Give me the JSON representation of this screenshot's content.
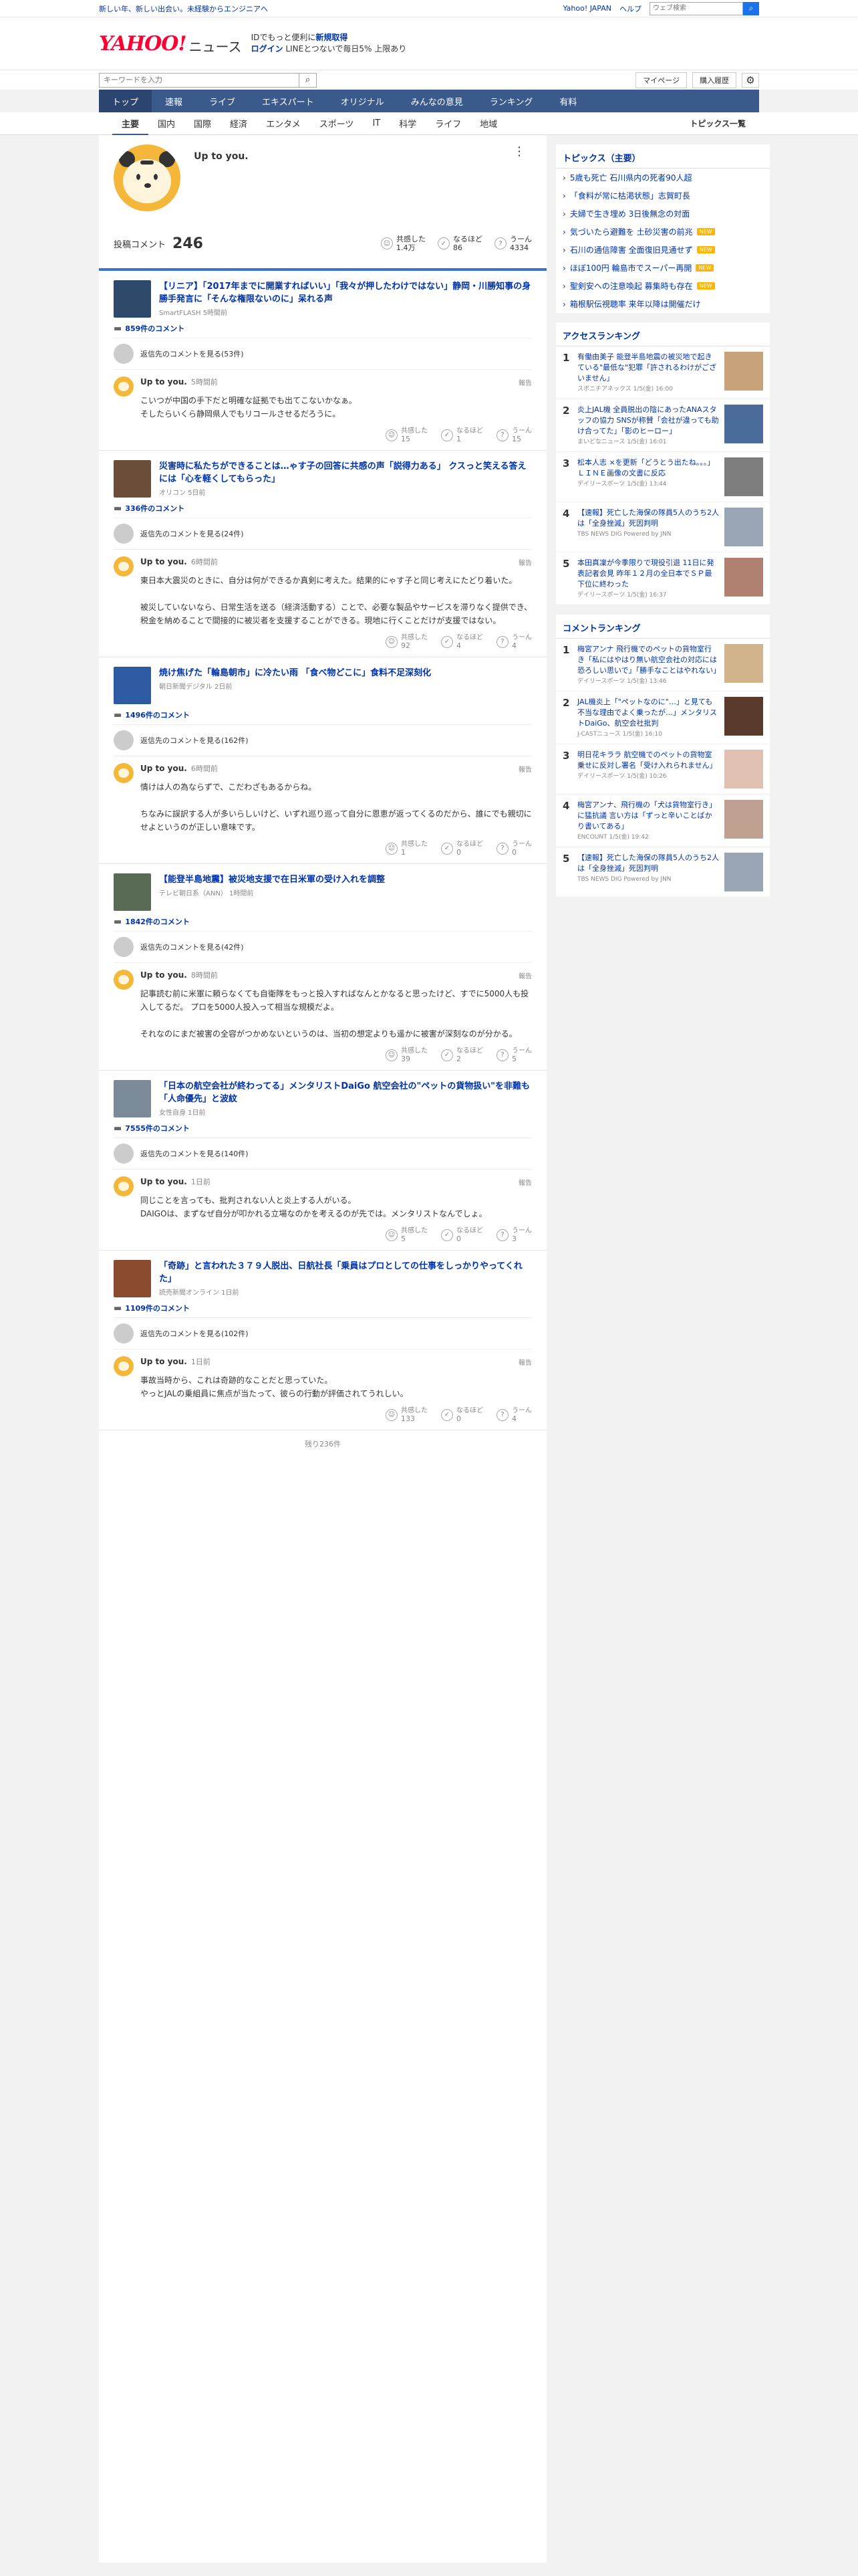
{
  "topbar": {
    "promo": "新しい年、新しい出会い。未経験からエンジニアへ",
    "links": [
      "Yahoo! JAPAN",
      "ヘルプ"
    ],
    "search_placeholder": "ウェブ検索"
  },
  "header": {
    "logo_text": "YAHOO!",
    "logo_sub": "JAPAN",
    "logo_service": "ニュース",
    "promo_line1_a": "IDでもっと便利に",
    "promo_line1_b": "新規取得",
    "promo_line2_a": "ログイン",
    "promo_line2_b": "LINEとつないで毎日5%",
    "promo_line2_c": "上限あり"
  },
  "subbar": {
    "keyword_placeholder": "キーワードを入力",
    "mypage": "マイページ",
    "purchase": "購入履歴"
  },
  "gnav": [
    "トップ",
    "速報",
    "ライブ",
    "エキスパート",
    "オリジナル",
    "みんなの意見",
    "ランキング",
    "有料"
  ],
  "cnav": [
    "主要",
    "国内",
    "国際",
    "経済",
    "エンタメ",
    "スポーツ",
    "IT",
    "科学",
    "ライフ",
    "地域"
  ],
  "cnav_all": "トピックス一覧",
  "profile": {
    "name": "Up to you.",
    "comments_label": "投稿コメント",
    "comments_count": "246",
    "reactions": [
      {
        "label": "共感した",
        "value": "1.4万"
      },
      {
        "label": "なるほど",
        "value": "86"
      },
      {
        "label": "うーん",
        "value": "4334"
      }
    ]
  },
  "reaction_labels": [
    "共感した",
    "なるほど",
    "うーん"
  ],
  "blocks": [
    {
      "title": "【リニア】「2017年までに開業すればいい」「我々が押したわけではない」静岡・川勝知事の身勝手発言に「そんな権限ないのに」呆れる声",
      "source": "SmartFLASH 5時間前",
      "count": "859件のコメント",
      "reply_line": "返信先のコメントを見る(53件)",
      "time": "5時間前",
      "text": "こいつが中国の手下だと明確な証拠でも出てこないかなぁ。\nそしたらいくら静岡県人でもリコールさせるだろうに。",
      "r": [
        "15",
        "1",
        "15"
      ]
    },
    {
      "title": "災害時に私たちができることは…ゃす子の回答に共感の声「説得力ある」 クスっと笑える答えには「心を軽くしてもらった」",
      "source": "オリコン 5日前",
      "count": "336件のコメント",
      "reply_line": "返信先のコメントを見る(24件)",
      "time": "6時間前",
      "text": "東日本大震災のときに、自分は何ができるか真剣に考えた。結果的にゃす子と同じ考えにたどり着いた。\n\n被災していないなら、日常生活を送る（経済活動する）ことで、必要な製品やサービスを滞りなく提供でき、税金を納めることで間接的に被災者を支援することができる。現地に行くことだけが支援ではない。",
      "r": [
        "92",
        "4",
        "4"
      ]
    },
    {
      "title": "焼け焦げた「輪島朝市」に冷たい雨 「食べ物どこに」食料不足深刻化",
      "source": "朝日新聞デジタル 2日前",
      "count": "1496件のコメント",
      "reply_line": "返信先のコメントを見る(162件)",
      "time": "6時間前",
      "text": "情けは人の為ならずで、こだわざもあるからね。\n\nちなみに誤訳する人が多いらしいけど、いずれ巡り巡って自分に恩恵が返ってくるのだから、誰にでも親切にせよというのが正しい意味です。",
      "r": [
        "1",
        "0",
        "0"
      ]
    },
    {
      "title": "【能登半島地震】被災地支援で在日米軍の受け入れを調整",
      "source": "テレビ朝日系（ANN） 1時間前",
      "count": "1842件のコメント",
      "reply_line": "返信先のコメントを見る(42件)",
      "time": "8時間前",
      "text": "記事読む前に米軍に頼らなくても自衛隊をもっと投入すればなんとかなると思ったけど、すでに5000人も投入してるだ。 プロを5000人投入って相当な規模だよ。\n\nそれなのにまだ被害の全容がつかめないというのは、当初の想定よりも遥かに被害が深刻なのが分かる。",
      "r": [
        "39",
        "2",
        "5"
      ]
    },
    {
      "title": "「日本の航空会社が終わってる」メンタリストDaiGo 航空会社の\"ペットの貨物扱い\"を非難も「人命優先」と波紋",
      "source": "女性自身 1日前",
      "count": "7555件のコメント",
      "reply_line": "返信先のコメントを見る(140件)",
      "time": "1日前",
      "text": "同じことを言っても、批判されない人と炎上する人がいる。\nDAIGOは、まずなぜ自分が叩かれる立場なのかを考えるのが先では。メンタリストなんでしょ。",
      "r": [
        "5",
        "0",
        "3"
      ]
    },
    {
      "title": "「奇跡」と言われた３７９人脱出、日航社長「乗員はプロとしての仕事をしっかりやってくれた」",
      "source": "読売新聞オンライン 1日前",
      "count": "1109件のコメント",
      "reply_line": "返信先のコメントを見る(102件)",
      "time": "1日前",
      "text": "事故当時から、これは奇跡的なことだと思っていた。\nやっとJALの乗組員に焦点が当たって、彼らの行動が評価されてうれしい。",
      "r": [
        "133",
        "0",
        "4"
      ]
    }
  ],
  "pager": "残り236件",
  "side": {
    "topics_title": "トピックス（主要）",
    "topics": [
      {
        "t": "5歳も死亡 石川県内の死者90人超",
        "b": ""
      },
      {
        "t": "「食料が常に枯渇状態」志賀町長",
        "b": ""
      },
      {
        "t": "夫婦で生き埋め 3日後無念の対面",
        "b": ""
      },
      {
        "t": "気づいたら避難を 土砂災害の前兆",
        "b": "NEW"
      },
      {
        "t": "石川の通信障害 全面復旧見通せず",
        "b": "NEW"
      },
      {
        "t": "ほぼ100円 輪島市でスーパー再開",
        "b": "NEW"
      },
      {
        "t": "聖剣安への注意喚起 募集時も存在",
        "b": "NEW"
      },
      {
        "t": "箱根駅伝視聴率 来年以降は開催だけ",
        "b": ""
      }
    ],
    "access_title": "アクセスランキング",
    "access": [
      {
        "no": "1",
        "t": "有働由美子 能登半島地震の被災地で起きている\"最低な\"犯罪「許されるわけがございません」",
        "s": "スポニチアネックス 1/5(金) 16:00"
      },
      {
        "no": "2",
        "t": "炎上JAL機 全員脱出の陰にあったANAスタッフの協力 SNSが称賛「会社が違っても助け合ってた」「影のヒーロー」",
        "s": "まいどなニュース 1/5(金) 16:01"
      },
      {
        "no": "3",
        "t": "松本人志 ×を更新「どうとう出たね。。。」ＬＩＮＥ画像の文書に反応",
        "s": "デイリースポーツ 1/5(金) 13:44"
      },
      {
        "no": "4",
        "t": "【速報】死亡した海保の隊員5人のうち2人は「全身挫滅」死因判明",
        "s": "TBS NEWS DIG Powered by JNN"
      },
      {
        "no": "5",
        "t": "本田真凜が今季限りで現役引退 11日に発表記者会見 昨年１２月の全日本でＳＰ最下位に終わった",
        "s": "デイリースポーツ 1/5(金) 16:37"
      }
    ],
    "comment_title": "コメントランキング",
    "comment": [
      {
        "no": "1",
        "t": "梅宮アンナ 飛行機でのペットの貨物室行き「私にはやはり無い航空会社の対応には恐ろしい思いで」「勝手なことはやれない」",
        "s": "デイリースポーツ 1/5(金) 13:46"
      },
      {
        "no": "2",
        "t": "JAL機炎上「\"ペットなのに\"…」と見ても不当な理由でよく乗ったが…」メンタリストDaiGo、航空会社批判",
        "s": "J-CASTニュース 1/5(金) 16:10"
      },
      {
        "no": "3",
        "t": "明日花キララ 航空機でのペットの貨物室乗せに反対し署名「受け入れられません」",
        "s": "デイリースポーツ 1/5(金) 10:26"
      },
      {
        "no": "4",
        "t": "梅宮アンナ、飛行機の「犬は貨物室行き」に猛抗議 言い方は「ずっと辛いことばかり書いてある」",
        "s": "ENCOUNT 1/5(金) 19:42"
      },
      {
        "no": "5",
        "t": "【速報】死亡した海保の隊員5人のうち2人は「全身挫滅」死因判明",
        "s": "TBS NEWS DIG Powered by JNN"
      }
    ]
  }
}
